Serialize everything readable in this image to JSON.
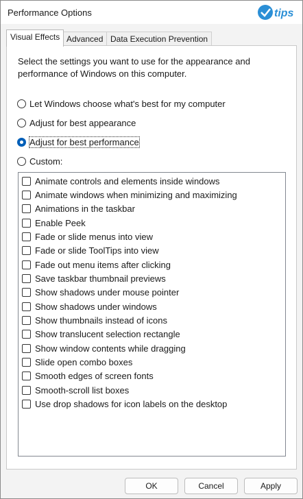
{
  "window": {
    "title": "Performance Options"
  },
  "logo": {
    "text": "tips",
    "color": "#2b8fd6"
  },
  "tabs": [
    {
      "label": "Visual Effects",
      "active": true
    },
    {
      "label": "Advanced",
      "active": false
    },
    {
      "label": "Data Execution Prevention",
      "active": false
    }
  ],
  "description": "Select the settings you want to use for the appearance and performance of Windows on this computer.",
  "options": [
    {
      "label": "Let Windows choose what's best for my computer",
      "checked": false
    },
    {
      "label": "Adjust for best appearance",
      "checked": false
    },
    {
      "label": "Adjust for best performance",
      "checked": true
    },
    {
      "label": "Custom:",
      "checked": false
    }
  ],
  "effects": [
    {
      "label": "Animate controls and elements inside windows",
      "checked": false
    },
    {
      "label": "Animate windows when minimizing and maximizing",
      "checked": false
    },
    {
      "label": "Animations in the taskbar",
      "checked": false
    },
    {
      "label": "Enable Peek",
      "checked": false
    },
    {
      "label": "Fade or slide menus into view",
      "checked": false
    },
    {
      "label": "Fade or slide ToolTips into view",
      "checked": false
    },
    {
      "label": "Fade out menu items after clicking",
      "checked": false
    },
    {
      "label": "Save taskbar thumbnail previews",
      "checked": false
    },
    {
      "label": "Show shadows under mouse pointer",
      "checked": false
    },
    {
      "label": "Show shadows under windows",
      "checked": false
    },
    {
      "label": "Show thumbnails instead of icons",
      "checked": false
    },
    {
      "label": "Show translucent selection rectangle",
      "checked": false
    },
    {
      "label": "Show window contents while dragging",
      "checked": false
    },
    {
      "label": "Slide open combo boxes",
      "checked": false
    },
    {
      "label": "Smooth edges of screen fonts",
      "checked": false
    },
    {
      "label": "Smooth-scroll list boxes",
      "checked": false
    },
    {
      "label": "Use drop shadows for icon labels on the desktop",
      "checked": false
    }
  ],
  "buttons": {
    "ok": "OK",
    "cancel": "Cancel",
    "apply": "Apply"
  },
  "colors": {
    "accent": "#005fb8",
    "background": "#f3f3f3",
    "panel": "#ffffff"
  }
}
